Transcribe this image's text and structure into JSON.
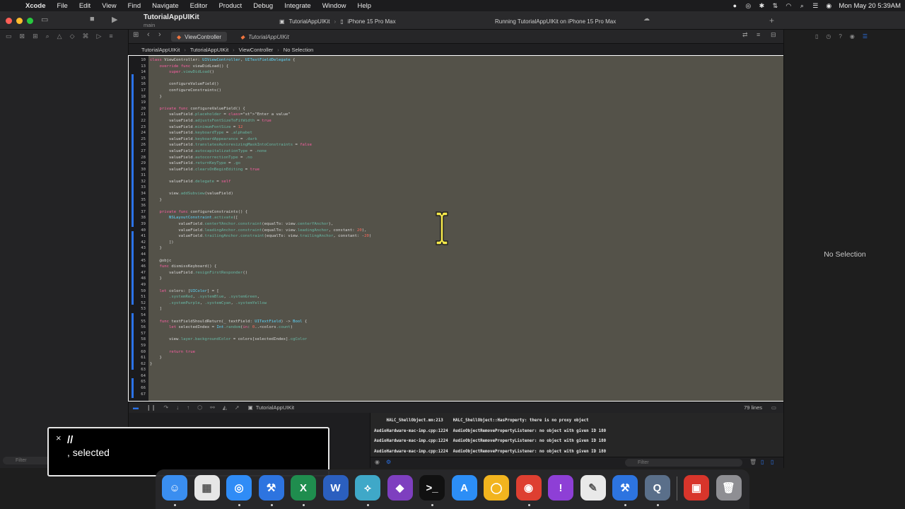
{
  "menubar": {
    "items": [
      "Xcode",
      "File",
      "Edit",
      "View",
      "Find",
      "Navigate",
      "Editor",
      "Product",
      "Debug",
      "Integrate",
      "Window",
      "Help"
    ],
    "clock": "Mon May 20  5:39AM"
  },
  "toolbar": {
    "project_title": "TutorialAppUIKit",
    "branch": "main",
    "scheme": "TutorialAppUIKit",
    "destination": "iPhone 15 Pro Max",
    "status": "Running TutorialAppUIKit on iPhone 15 Pro Max"
  },
  "tabs": [
    {
      "label": "ViewController"
    },
    {
      "label": "TutorialAppUIKit"
    }
  ],
  "jumpbar": [
    "TutorialAppUIKit",
    "TutorialAppUIKit",
    "ViewController",
    "No Selection"
  ],
  "code_lines": [
    {
      "n": "10",
      "t": "class ViewController: UIViewController, UITextFieldDelegate {"
    },
    {
      "n": "13",
      "t": "    override func viewDidLoad() {"
    },
    {
      "n": "14",
      "t": "        super.viewDidLoad()"
    },
    {
      "n": "15",
      "t": ""
    },
    {
      "n": "16",
      "t": "        configureValueField()"
    },
    {
      "n": "17",
      "t": "        configureConstraints()"
    },
    {
      "n": "18",
      "t": "    }"
    },
    {
      "n": "19",
      "t": ""
    },
    {
      "n": "20",
      "t": "    private func configureValueField() {"
    },
    {
      "n": "21",
      "t": "        valueField.placeholder = \"Enter a value\""
    },
    {
      "n": "22",
      "t": "        valueField.adjustsFontSizeToFitWidth = true"
    },
    {
      "n": "23",
      "t": "        valueField.minimumFontSize = 12"
    },
    {
      "n": "24",
      "t": "        valueField.keyboardType = .alphabet"
    },
    {
      "n": "25",
      "t": "        valueField.keyboardAppearance = .dark"
    },
    {
      "n": "26",
      "t": "        valueField.translatesAutoresizingMaskIntoConstraints = false"
    },
    {
      "n": "27",
      "t": "        valueField.autocapitalizationType = .none"
    },
    {
      "n": "28",
      "t": "        valueField.autocorrectionType = .no"
    },
    {
      "n": "29",
      "t": "        valueField.returnKeyType = .go"
    },
    {
      "n": "30",
      "t": "        valueField.clearsOnBeginEditing = true"
    },
    {
      "n": "31",
      "t": ""
    },
    {
      "n": "32",
      "t": "        valueField.delegate = self"
    },
    {
      "n": "33",
      "t": ""
    },
    {
      "n": "34",
      "t": "        view.addSubview(valueField)"
    },
    {
      "n": "35",
      "t": "    }"
    },
    {
      "n": "36",
      "t": ""
    },
    {
      "n": "37",
      "t": "    private func configureConstraints() {"
    },
    {
      "n": "38",
      "t": "        NSLayoutConstraint.activate(["
    },
    {
      "n": "39",
      "t": "            valueField.centerYAnchor.constraint(equalTo: view.centerYAnchor),"
    },
    {
      "n": "40",
      "t": "            valueField.leadingAnchor.constraint(equalTo: view.leadingAnchor, constant: 20),"
    },
    {
      "n": "41",
      "t": "            valueField.trailingAnchor.constraint(equalTo: view.trailingAnchor, constant: -20)"
    },
    {
      "n": "42",
      "t": "        ])"
    },
    {
      "n": "43",
      "t": "    }"
    },
    {
      "n": "44",
      "t": ""
    },
    {
      "n": "45",
      "t": "    @objc"
    },
    {
      "n": "46",
      "t": "    func dismissKeyboard() {"
    },
    {
      "n": "47",
      "t": "        valueField.resignFirstResponder()"
    },
    {
      "n": "48",
      "t": "    }"
    },
    {
      "n": "49",
      "t": ""
    },
    {
      "n": "50",
      "t": "    let colors: [UIColor] = ["
    },
    {
      "n": "51",
      "t": "        .systemRed, .systemBlue, .systemGreen,"
    },
    {
      "n": "52",
      "t": "        .systemPurple, .systemCyan, .systemYellow"
    },
    {
      "n": "53",
      "t": "    ]"
    },
    {
      "n": "54",
      "t": ""
    },
    {
      "n": "55",
      "t": "    func textFieldShouldReturn(_ textField: UITextField) -> Bool {"
    },
    {
      "n": "56",
      "t": "        let selectedIndex = Int.random(in: 0..<colors.count)"
    },
    {
      "n": "57",
      "t": ""
    },
    {
      "n": "58",
      "t": "        view.layer.backgroundColor = colors[selectedIndex].cgColor"
    },
    {
      "n": "59",
      "t": ""
    },
    {
      "n": "60",
      "t": "        return true"
    },
    {
      "n": "61",
      "t": "    }"
    },
    {
      "n": "62",
      "t": "}"
    },
    {
      "n": "63",
      "t": ""
    },
    {
      "n": "64",
      "t": ""
    },
    {
      "n": "65",
      "t": ""
    },
    {
      "n": "66",
      "t": ""
    },
    {
      "n": "67",
      "t": ""
    }
  ],
  "editor_status": {
    "scheme": "TutorialAppUIKit",
    "line_count": "79 lines"
  },
  "console_lines": [
    "     HALC_ShellObject.mm:213    HALC_ShellObject::HasProperty: there is no proxy object",
    "AudioHardware-mac-imp.cpp:1224  AudioObjectRemovePropertyListener: no object with given ID 180",
    "AudioHardware-mac-imp.cpp:1224  AudioObjectRemovePropertyListener: no object with given ID 180",
    "AudioHardware-mac-imp.cpp:1224  AudioObjectRemovePropertyListener: no object with given ID 180"
  ],
  "filters": {
    "left": "Filter",
    "right": "Filter"
  },
  "inspector": {
    "empty_label": "No Selection"
  },
  "caption": {
    "line1": "//",
    "line2": ", selected"
  },
  "dock": [
    {
      "name": "finder-icon",
      "color": "#3a8ef0",
      "glyph": "☺",
      "dot": true
    },
    {
      "name": "launchpad-icon",
      "color": "#e6e6e6",
      "glyph": "▦",
      "dot": false
    },
    {
      "name": "safari-icon",
      "color": "#2f8cf6",
      "glyph": "◎",
      "dot": true
    },
    {
      "name": "xcode-icon",
      "color": "#2d74e0",
      "glyph": "⚒",
      "dot": true
    },
    {
      "name": "excel-icon",
      "color": "#1f8d4e",
      "glyph": "X",
      "dot": true
    },
    {
      "name": "word-icon",
      "color": "#2b5fbf",
      "glyph": "W",
      "dot": false
    },
    {
      "name": "sourcetree-icon",
      "color": "#3fa8c8",
      "glyph": "⟡",
      "dot": true
    },
    {
      "name": "visual-studio-icon",
      "color": "#7e3fbf",
      "glyph": "◆",
      "dot": false
    },
    {
      "name": "terminal-icon",
      "color": "#111111",
      "glyph": ">_",
      "dot": true
    },
    {
      "name": "app-store-icon",
      "color": "#2c8ef6",
      "glyph": "A",
      "dot": false
    },
    {
      "name": "amphetamine-icon",
      "color": "#f2b41e",
      "glyph": "◯",
      "dot": false
    },
    {
      "name": "chrome-icon",
      "color": "#de3f31",
      "glyph": "◉",
      "dot": true
    },
    {
      "name": "feedback-icon",
      "color": "#8e3fd6",
      "glyph": "!",
      "dot": false
    },
    {
      "name": "textedit-icon",
      "color": "#e9e9e9",
      "glyph": "✎",
      "dot": false
    },
    {
      "name": "simulator-icon",
      "color": "#2d74e0",
      "glyph": "⚒",
      "dot": true
    },
    {
      "name": "quicktime-icon",
      "color": "#5a6f8a",
      "glyph": "Q",
      "dot": true
    },
    {
      "name": "archive-utility-icon",
      "color": "#d8352b",
      "glyph": "▣",
      "dot": false
    },
    {
      "name": "trash-icon",
      "color": "#8e8e93",
      "glyph": "🗑",
      "dot": false
    }
  ]
}
